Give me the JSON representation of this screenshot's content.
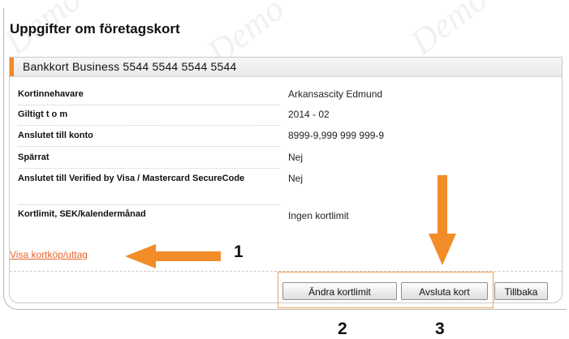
{
  "page": {
    "title": "Uppgifter om företagskort"
  },
  "card": {
    "header": "Bankkort Business 5544 5544 5544 5544",
    "rows": [
      {
        "label": "Kortinnehavare",
        "value": "Arkansascity Edmund"
      },
      {
        "label": "Giltigt t o m",
        "value": "2014 - 02"
      },
      {
        "label": "Anslutet till konto",
        "value": "8999-9,999 999 999-9"
      },
      {
        "label": "Spärrat",
        "value": "Nej"
      },
      {
        "label": "Anslutet till Verified by Visa / Mastercard SecureCode",
        "value": "Nej"
      },
      {
        "label": "Kortlimit, SEK/kalendermånad",
        "value": "Ingen kortlimit"
      }
    ],
    "link_text": "Visa kortköp/uttag"
  },
  "buttons": {
    "change_limit": "Ändra kortlimit",
    "close_card": "Avsluta kort",
    "back": "Tillbaka"
  },
  "annotations": {
    "one": "1",
    "two": "2",
    "three": "3"
  },
  "watermark": "Demo",
  "colors": {
    "accent": "#f08a24",
    "link": "#e8652b",
    "arrow": "#f28c28"
  }
}
